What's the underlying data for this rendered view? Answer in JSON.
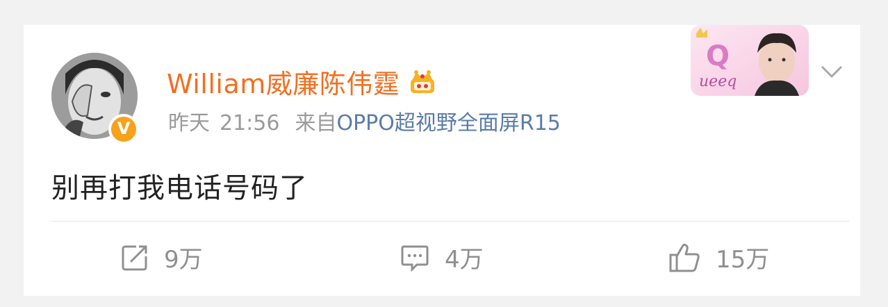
{
  "post": {
    "author": {
      "name": "William威廉陈伟霆",
      "verified_badge": "V",
      "membership_icon": "crown-icon"
    },
    "meta": {
      "date": "昨天",
      "time": "21:56",
      "from_label": "来自",
      "device": "OPPO超视野全面屏R15"
    },
    "text": "别再打我电话号码了",
    "banner_text": "Q",
    "banner_script": "ueeq",
    "actions": {
      "repost": {
        "icon": "repost-icon",
        "count": "9万"
      },
      "comment": {
        "icon": "comment-icon",
        "count": "4万"
      },
      "like": {
        "icon": "thumbs-up-icon",
        "count": "15万"
      }
    }
  },
  "colors": {
    "username": "#f26f21",
    "link": "#5a7ca8",
    "muted": "#9a9a9a",
    "badge": "#f7a21b"
  }
}
